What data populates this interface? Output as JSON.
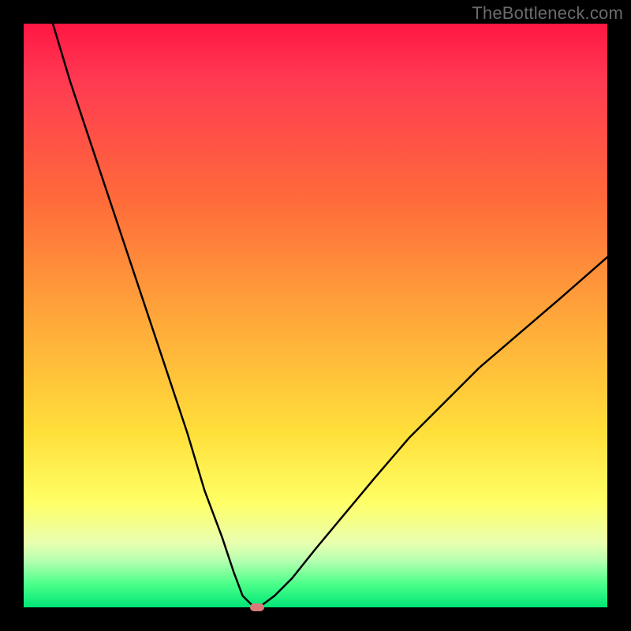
{
  "watermark": "TheBottleneck.com",
  "chart_data": {
    "type": "line",
    "title": "",
    "xlabel": "",
    "ylabel": "",
    "xlim": [
      0,
      100
    ],
    "ylim": [
      0,
      100
    ],
    "grid": false,
    "series": [
      {
        "name": "bottleneck-curve",
        "x": [
          5,
          8,
          12,
          16,
          20,
          24,
          28,
          31,
          34,
          36,
          37.5,
          39,
          40,
          41,
          43,
          46,
          50,
          55,
          60,
          66,
          72,
          78,
          85,
          92,
          100
        ],
        "y": [
          100,
          90,
          78,
          66,
          54,
          42,
          30,
          20,
          12,
          6,
          2,
          0.5,
          0,
          0.5,
          2,
          5,
          10,
          16,
          22,
          29,
          35,
          41,
          47,
          53,
          60
        ]
      }
    ],
    "annotations": [
      {
        "name": "minimum-marker",
        "x": 40,
        "y": 0
      }
    ],
    "style": {
      "curve_color": "#000000",
      "marker_color": "#d97a7a",
      "background_gradient_top": "#ff1744",
      "background_gradient_bottom": "#00e676"
    }
  }
}
